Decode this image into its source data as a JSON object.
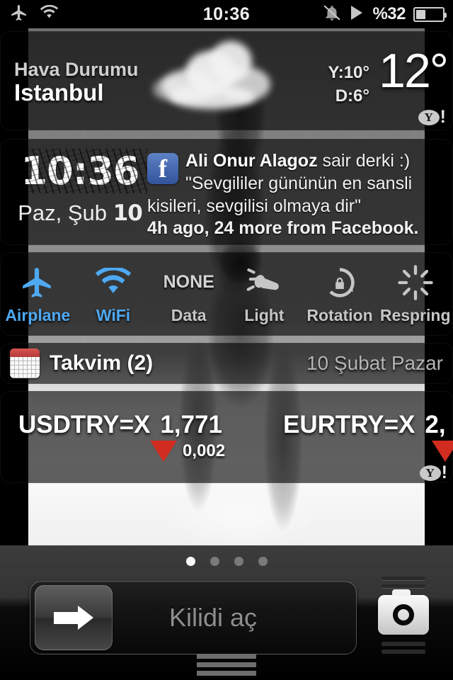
{
  "status_bar": {
    "airplane_icon": "airplane-icon",
    "wifi_icon": "wifi-icon",
    "time": "10:36",
    "mute_icon": "bell-mute-icon",
    "play_icon": "play-icon",
    "battery_percent": "%32",
    "battery_level": 35
  },
  "weather": {
    "label": "Hava Durumu",
    "city": "Istanbul",
    "high": "Y:10°",
    "low": "D:6°",
    "temperature": "12°",
    "condition_icon": "cloud-icon",
    "provider_y": "Y",
    "provider_bang": "!"
  },
  "clock": {
    "time": "10:36",
    "date_prefix": "Paz, Şub ",
    "date_day": "10"
  },
  "facebook": {
    "icon": "f",
    "author": "Ali Onur Alagoz",
    "action": " sair derki :)",
    "body": "\"Sevgililer gününün en sansli kisileri, sevgilisi olmaya dir\"",
    "meta": "4h ago, 24 more from Facebook."
  },
  "toggles": [
    {
      "label": "Airplane",
      "icon": "airplane-icon",
      "active": true,
      "value": ""
    },
    {
      "label": "WiFi",
      "icon": "wifi-icon",
      "active": true,
      "value": ""
    },
    {
      "label": "Data",
      "icon": "data-icon",
      "active": false,
      "value": "NONE"
    },
    {
      "label": "Light",
      "icon": "flashlight-icon",
      "active": false,
      "value": ""
    },
    {
      "label": "Rotation",
      "icon": "rotation-lock-icon",
      "active": false,
      "value": ""
    },
    {
      "label": "Respring",
      "icon": "respring-icon",
      "active": false,
      "value": ""
    }
  ],
  "calendar": {
    "icon": "calendar-icon",
    "title": "Takvim (2)",
    "date": "10 Şubat Pazar"
  },
  "stocks": {
    "items": [
      {
        "symbol": "USDTRY=X",
        "value": "1,771",
        "direction": "down",
        "delta": "0,002"
      },
      {
        "symbol": "EURTRY=X",
        "value": "2,",
        "direction": "down",
        "delta": ""
      }
    ],
    "provider_y": "Y",
    "provider_bang": "!"
  },
  "bottom": {
    "page_dots": 4,
    "active_dot": 0,
    "slide_text": "Kilidi aç",
    "arrow_icon": "arrow-right-icon",
    "camera_icon": "camera-icon"
  },
  "colors": {
    "accent_blue": "#4ea9f2",
    "stock_down_red": "#d02c20",
    "calendar_red": "#d9534f",
    "facebook_blue": "#3b5998"
  }
}
